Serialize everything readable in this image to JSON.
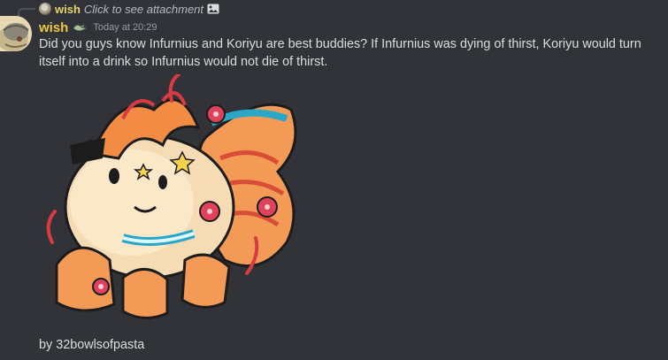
{
  "reply": {
    "author": "wish",
    "text": "Click to see attachment",
    "avatar_icon": "avatar-icon",
    "attachment_icon": "image-icon"
  },
  "message": {
    "author": "wish",
    "author_color": "#f0c841",
    "badge_icon": "dragon-badge-icon",
    "timestamp": "Today at 20:29",
    "text": "Did you guys know Infurnius and Koriyu are best buddies? If Infurnius was dying of thirst, Koriyu would turn itself into a drink so Infurnius would not die of thirst.",
    "attachment_caption": "by 32bowlsofpasta",
    "attachment_subject": "fluffy-creature-artwork"
  },
  "colors": {
    "background": "#313338",
    "text": "#dbdee1",
    "muted": "#949ba4"
  }
}
